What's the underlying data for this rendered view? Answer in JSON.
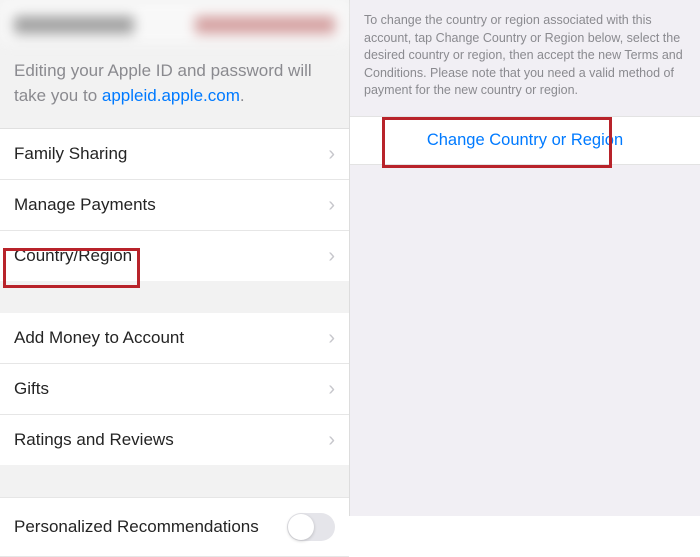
{
  "leftPanel": {
    "infoPrefix": "Editing your Apple ID and password will take you to ",
    "infoLink": "appleid.apple.com",
    "infoSuffix": ".",
    "group1": [
      {
        "label": "Family Sharing"
      },
      {
        "label": "Manage Payments"
      },
      {
        "label": "Country/Region"
      }
    ],
    "group2": [
      {
        "label": "Add Money to Account"
      },
      {
        "label": "Gifts"
      },
      {
        "label": "Ratings and Reviews"
      }
    ],
    "personalized": {
      "label": "Personalized Recommendations"
    }
  },
  "rightPanel": {
    "info": "To change the country or region associated with this account, tap Change Country or Region below, select the desired country or region, then accept the new Terms and Conditions. Please note that you need a valid method of payment for the new country or region.",
    "buttonLabel": "Change Country or Region"
  }
}
